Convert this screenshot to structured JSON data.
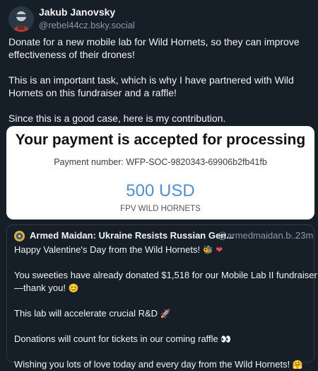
{
  "post": {
    "author_name": "Jakub Janovsky",
    "author_handle": "@rebel44cz.bsky.social",
    "lines": [
      "Donate for a new mobile lab for Wild Hornets, so they can improve",
      "effectiveness of their drones!",
      "This is an important task, which is why I have partnered with Wild",
      "Hornets on this fundraiser and a raffle!",
      "Since this is a good case, here is my contribution."
    ]
  },
  "image": {
    "title": "Your payment is accepted for processing",
    "payment_number": "Payment number: WFP-SOC-9820343-69906b2fb41fb",
    "amount": "500 USD",
    "recipient": "FPV WILD HORNETS"
  },
  "quote": {
    "author_name": "Armed Maidan: Ukraine Resists Russian Gen...",
    "author_handle": "@armedmaidan.b...",
    "separator": "·",
    "time": "23m",
    "lines": [
      "Happy Valentine's Day from the Wild Hornets!",
      "You sweeties have already donated $1,518 for our Mobile Lab II fundraiser",
      "—thank you!",
      "This lab will accelerate crucial R&D",
      "Donations will count for tickets in our coming raffle",
      "Wishing you lots of love today and every day from the Wild Hornets!"
    ],
    "emojis": {
      "hornet": "🐝",
      "heart": "❤",
      "point_down": "👇",
      "smile": "😊",
      "rocket": "🚀",
      "eyes": "👀",
      "hug": "🤗"
    }
  },
  "colors": {
    "background": "#161e27",
    "muted_text": "#8c9bab",
    "amount_blue": "#4f8fce"
  }
}
